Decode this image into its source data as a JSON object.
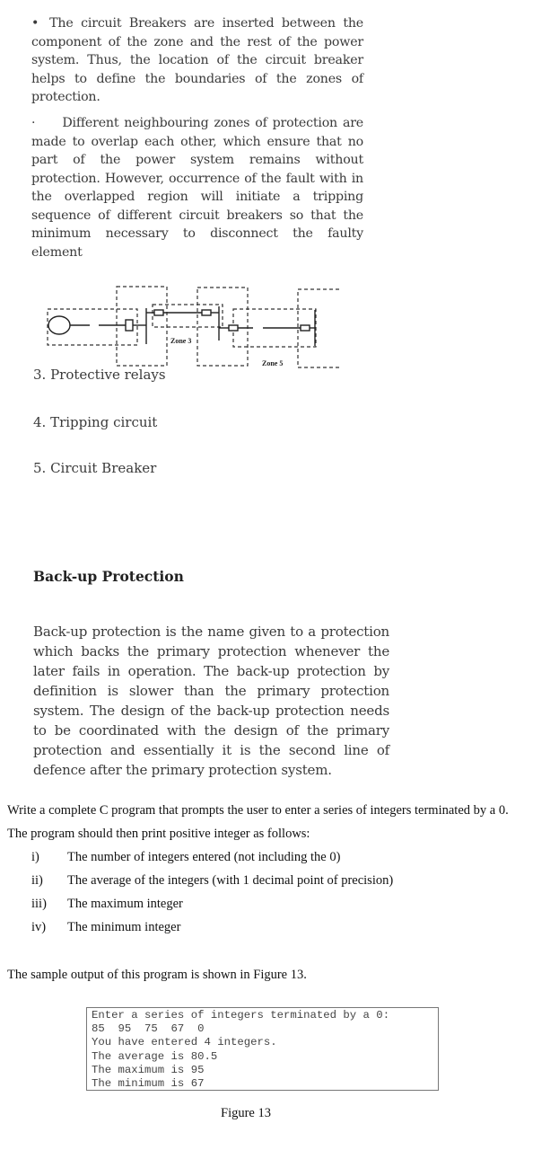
{
  "paragraph1": {
    "bullet": "•",
    "text": "The circuit Breakers are inserted between the component of the zone and the rest of the power system. Thus, the location of the circuit breaker helps to define the boundaries of the zones of protection."
  },
  "paragraph2": {
    "bullet": "·",
    "text": "Different neighbouring zones of protection are made to overlap each other, which ensure that no part of the power system remains without protection. However, occurrence of the fault with in the overlapped region will initiate a tripping sequence of different circuit breakers so that the minimum necessary to disconnect the faulty element"
  },
  "diagram": {
    "labels": [
      "Zone 3",
      "Zone 5"
    ]
  },
  "list_items": [
    "3. Protective relays",
    "4. Tripping circuit",
    "5. Circuit Breaker"
  ],
  "backup": {
    "heading": "Back-up Protection",
    "text": "Back-up protection is the name given to a protection which backs the primary protection whenever the later fails in operation. The back-up protection by definition is slower than the primary protection system. The design of the back-up protection needs to be coordinated with the design of the primary protection and essentially it is the second line of defence after the primary protection system."
  },
  "question": {
    "line1": "Write a complete C program that prompts the user to enter a series of integers terminated by a 0.",
    "line2": "The program should then print positive integer as follows:",
    "items": [
      {
        "num": "i)",
        "text": "The number of integers entered (not including the 0)"
      },
      {
        "num": "ii)",
        "text": "The average of the integers (with 1 decimal point of precision)"
      },
      {
        "num": "iii)",
        "text": "The maximum integer"
      },
      {
        "num": "iv)",
        "text": "The minimum integer"
      }
    ],
    "sample_intro": "The sample output of this program is shown in Figure 13."
  },
  "figure": {
    "lines": [
      "Enter a series of integers terminated by a 0:",
      "85  95  75  67  0",
      "You have entered 4 integers.",
      "The average is 80.5",
      "The maximum is 95",
      "The minimum is 67"
    ],
    "caption": "Figure 13"
  }
}
